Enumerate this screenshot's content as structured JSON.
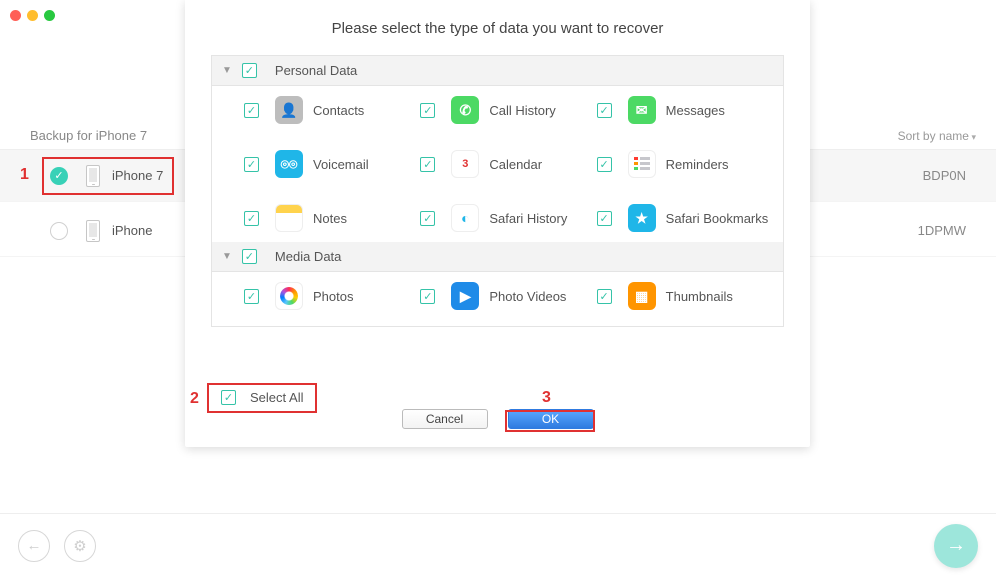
{
  "window": {
    "backup_label": "Backup for iPhone 7",
    "sort_label": "Sort by name"
  },
  "devices": [
    {
      "name": "iPhone 7",
      "serial_tail": "BDP0N",
      "selected": true
    },
    {
      "name": "iPhone",
      "serial_tail": "1DPMW",
      "selected": false
    }
  ],
  "modal": {
    "title": "Please select the type of data you want to recover",
    "groups": [
      {
        "title": "Personal Data",
        "items": [
          "Contacts",
          "Call History",
          "Messages",
          "Voicemail",
          "Calendar",
          "Reminders",
          "Notes",
          "Safari History",
          "Safari Bookmarks"
        ]
      },
      {
        "title": "Media Data",
        "items": [
          "Photos",
          "Photo Videos",
          "Thumbnails"
        ]
      }
    ],
    "select_all": "Select All",
    "cancel": "Cancel",
    "ok": "OK",
    "calendar_day": "3"
  },
  "annotations": {
    "1": "1",
    "2": "2",
    "3": "3"
  }
}
